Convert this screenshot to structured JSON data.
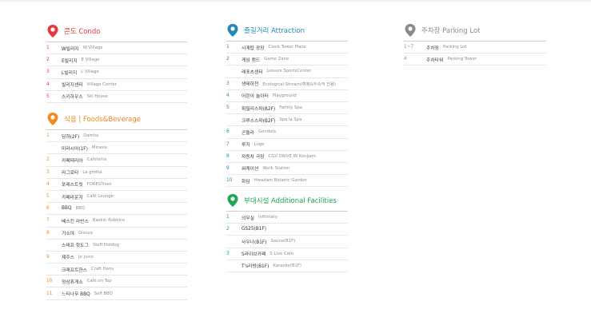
{
  "colors": {
    "condo": "#e6373a",
    "foods": "#f08a21",
    "attraction": "#2487b5",
    "additional": "#1aa74f",
    "parking": "#8a8a8a"
  },
  "condo": {
    "title": "콘도 Condo",
    "items": [
      {
        "num": "1",
        "ko": "W빌리지",
        "en": "W Village"
      },
      {
        "num": "2",
        "ko": "E빌리지",
        "en": "E Village"
      },
      {
        "num": "3",
        "ko": "L빌리지",
        "en": "L Village"
      },
      {
        "num": "4",
        "ko": "빌리지센터",
        "en": "Village Center"
      },
      {
        "num": "5",
        "ko": "스키하우스",
        "en": "Ski House"
      }
    ]
  },
  "foods": {
    "title": "식음 | Foods&Beverage",
    "items": [
      {
        "num": "1",
        "ko": "담하(2F)",
        "en": "Damha"
      },
      {
        "num": "",
        "ko": "미라시아(1F)",
        "en": "Mirasia"
      },
      {
        "num": "2",
        "ko": "카페테리아",
        "en": "Cafeteria"
      },
      {
        "num": "3",
        "ko": "라그로타",
        "en": "La grotta"
      },
      {
        "num": "4",
        "ko": "포레스트릿",
        "en": "FORESTreet"
      },
      {
        "num": "5",
        "ko": "카페라운지",
        "en": "Café Lounge"
      },
      {
        "num": "6",
        "ko": "BBQ",
        "en": "BBQ"
      },
      {
        "num": "7",
        "ko": "배스킨 라빈스",
        "en": "Baskin Robbins"
      },
      {
        "num": "8",
        "ko": "기소야",
        "en": "Gisoya"
      },
      {
        "num": "",
        "ko": "스테프 핫도그",
        "en": "Steff Hotdog"
      },
      {
        "num": "9",
        "ko": "제주스",
        "en": "Je Juice"
      },
      {
        "num": "",
        "ko": "크래프트한스",
        "en": "Craft Hans"
      },
      {
        "num": "10",
        "ko": "정상휴게소",
        "en": "Café on Top"
      },
      {
        "num": "11",
        "ko": "느티나무 BBQ",
        "en": "Self BBQ"
      }
    ]
  },
  "attraction": {
    "title": "즐길거리 Attraction",
    "items": [
      {
        "num": "1",
        "ko": "시계탑 광장",
        "en": "Clock Tower Plaza"
      },
      {
        "num": "2",
        "ko": "게임 랜드",
        "en": "Game Zone"
      },
      {
        "num": "",
        "ko": "레포츠센터",
        "en": "Leisure SportsCenter"
      },
      {
        "num": "3",
        "ko": "생태하천",
        "en": "Ecological Stream(휘핑&두속적 전용)"
      },
      {
        "num": "4",
        "ko": "어린이 놀이터",
        "en": "Playground"
      },
      {
        "num": "5",
        "ko": "휘릴리스파(B2F)",
        "en": "Family Spa"
      },
      {
        "num": "",
        "ko": "크루스스파(B2F)",
        "en": "Spa la Spa"
      },
      {
        "num": "6",
        "ko": "곤돌라",
        "en": "Gondola"
      },
      {
        "num": "7",
        "ko": "루지",
        "en": "Luge"
      },
      {
        "num": "8",
        "ko": "자동차 극장",
        "en": "CGV DRIVE IN Konjiam"
      },
      {
        "num": "9",
        "ko": "워케이션",
        "en": "Work Station"
      },
      {
        "num": "10",
        "ko": "화담",
        "en": "Hwadam Botanic Garden"
      }
    ]
  },
  "additional": {
    "title": "부대시설 Additional Facilities",
    "items": [
      {
        "num": "1",
        "ko": "의무실",
        "en": "Infirmary"
      },
      {
        "num": "2",
        "ko": "GS25(B1F)",
        "en": ""
      },
      {
        "num": "",
        "ko": "사우나(B1F)",
        "en": "Sauna(B1F)"
      },
      {
        "num": "3",
        "ko": "S라이브카페",
        "en": "S Live Cafe"
      },
      {
        "num": "",
        "ko": "T's라방(B1F)",
        "en": "Karaoke(B1F)"
      }
    ]
  },
  "parking": {
    "title": "주차장 Parking Lot",
    "items": [
      {
        "num": "1~7",
        "ko": "주차장",
        "en": "Parking Lot"
      },
      {
        "num": "4",
        "ko": "주차타워",
        "en": "Parking Tower"
      }
    ]
  }
}
